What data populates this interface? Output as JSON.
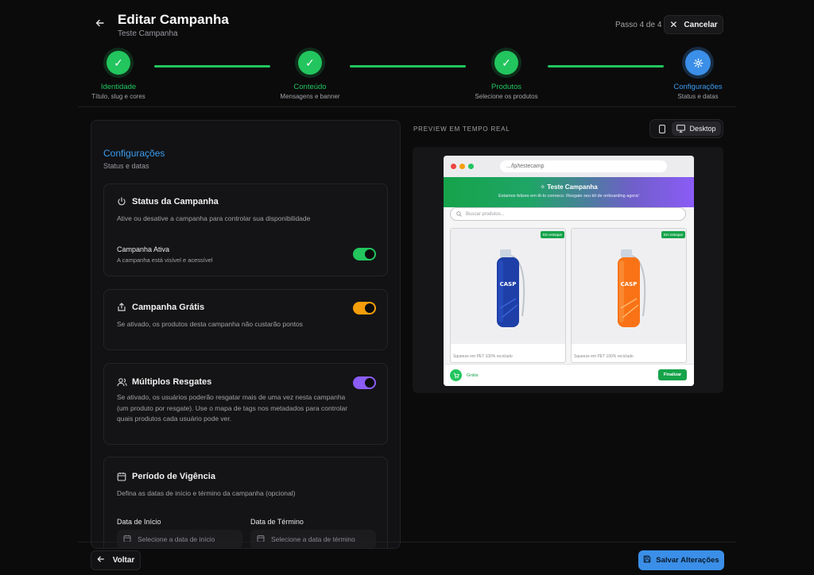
{
  "header": {
    "title": "Editar Campanha",
    "subtitle": "Teste Campanha",
    "step_info": "Passo 4 de 4",
    "cancel_label": "Cancelar"
  },
  "stepper": [
    {
      "label": "Identidade",
      "desc": "Título, slug e cores",
      "state": "done"
    },
    {
      "label": "Conteúdo",
      "desc": "Mensagens e banner",
      "state": "done"
    },
    {
      "label": "Produtos",
      "desc": "Selecione os produtos",
      "state": "done"
    },
    {
      "label": "Configurações",
      "desc": "Status e datas",
      "state": "active"
    }
  ],
  "settings": {
    "title": "Configurações",
    "subtitle": "Status e datas",
    "status_card": {
      "title": "Status da Campanha",
      "description": "Ative ou desative a campanha para controlar sua disponibilidade",
      "toggle_label": "Campanha Ativa",
      "toggle_desc": "A campanha está visível e acessível",
      "enabled": true,
      "color": "#22c55e"
    },
    "free_card": {
      "title": "Campanha Grátis",
      "description": "Se ativado, os produtos desta campanha não custarão pontos",
      "enabled": true,
      "color": "#f59e0b"
    },
    "multi_card": {
      "title": "Múltiplos Resgates",
      "description_1": "Se ativado, os usuários poderão resgatar mais de uma vez nesta campanha",
      "description_2": "(um produto por resgate). Use o mapa de tags nos metadados para controlar",
      "description_3": "quais produtos cada usuário pode ver.",
      "enabled": true,
      "color": "#8b5cf6"
    },
    "period_card": {
      "title": "Período de Vigência",
      "description": "Defina as datas de início e término da campanha (opcional)",
      "start_label": "Data de Início",
      "start_placeholder": "Selecione a data de início",
      "end_label": "Data de Término",
      "end_placeholder": "Selecione a data de término"
    }
  },
  "preview": {
    "label": "PREVIEW EM TEMPO REAL",
    "device_desktop": "Desktop",
    "url": ".../lp/testecamp",
    "hero_title": "Teste Campanha",
    "hero_subtitle": "Estamos felizes em tê-lo conosco. Resgate seu kit de onboarding agora!",
    "search_placeholder": "Buscar produtos...",
    "products": [
      {
        "name": "Squeeze em PET 100% reciclado",
        "badge": "Em estoque",
        "color": "#1e40af"
      },
      {
        "name": "Squeeze em PET 100% reciclado",
        "badge": "Em estoque",
        "color": "#f97316"
      }
    ],
    "cart_label": "Grátis",
    "finish_label": "Finalizar"
  },
  "footer": {
    "back_label": "Voltar",
    "save_label": "Salvar Alterações"
  },
  "colors": {
    "accent": "#3b8fe8",
    "success": "#22c55e"
  }
}
